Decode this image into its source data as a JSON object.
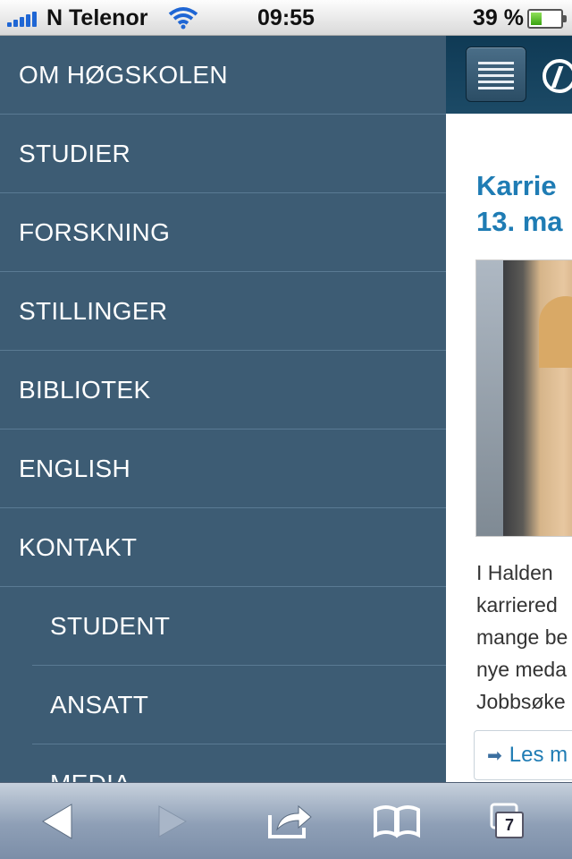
{
  "status_bar": {
    "carrier": "N Telenor",
    "time": "09:55",
    "battery_percent": "39 %",
    "battery_level": 0.39,
    "signal_bars": 5,
    "wifi_icon": "wifi-icon"
  },
  "menu": {
    "items": [
      {
        "label": "OM HØGSKOLEN",
        "sub": false
      },
      {
        "label": "STUDIER",
        "sub": false
      },
      {
        "label": "FORSKNING",
        "sub": false
      },
      {
        "label": "STILLINGER",
        "sub": false
      },
      {
        "label": "BIBLIOTEK",
        "sub": false
      },
      {
        "label": "ENGLISH",
        "sub": false
      },
      {
        "label": "KONTAKT",
        "sub": false
      },
      {
        "label": "STUDENT",
        "sub": true
      },
      {
        "label": "ANSATT",
        "sub": true
      },
      {
        "label": "MEDIA",
        "sub": true
      }
    ]
  },
  "content": {
    "menu_icon": "hamburger-menu-icon",
    "logo_icon": "hiof-logo-icon",
    "headline_line1": "Karrie",
    "headline_line2": "13. ma",
    "body_lines": [
      "I Halden",
      "karriered",
      "mange be",
      "nye meda",
      "Jobbsøke"
    ],
    "read_more_label": "Les m"
  },
  "toolbar": {
    "back_icon": "back-arrow-icon",
    "forward_icon": "forward-arrow-icon",
    "share_icon": "share-icon",
    "bookmarks_icon": "bookmarks-icon",
    "tabs_icon": "tabs-icon",
    "tabs_count": "7"
  },
  "colors": {
    "menu_bg": "#3d5c74",
    "link_blue": "#1f7cb4",
    "header_bg": "#0f3a55"
  }
}
